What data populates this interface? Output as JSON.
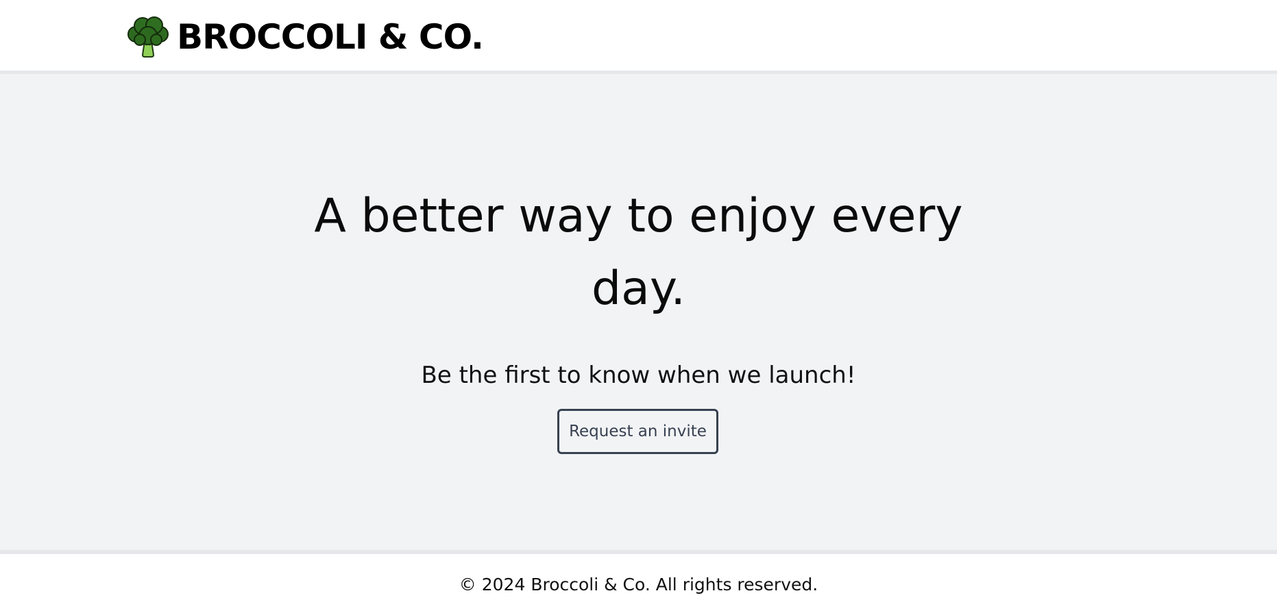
{
  "header": {
    "brand_name": "BROCCOLI & CO.",
    "logo_icon": "broccoli-icon"
  },
  "hero": {
    "title_line1": "A better way to enjoy every",
    "title_line2": "day.",
    "subtitle": "Be the first to know when we launch!",
    "cta_label": "Request an invite"
  },
  "footer": {
    "copyright": "© 2024 Broccoli & Co. All rights reserved."
  },
  "colors": {
    "background": "#f2f3f5",
    "border": "#e5e7eb",
    "button_border": "#374151",
    "text": "#111111",
    "broccoli_dark": "#2d6a1f",
    "broccoli_stem": "#8fcf57"
  }
}
